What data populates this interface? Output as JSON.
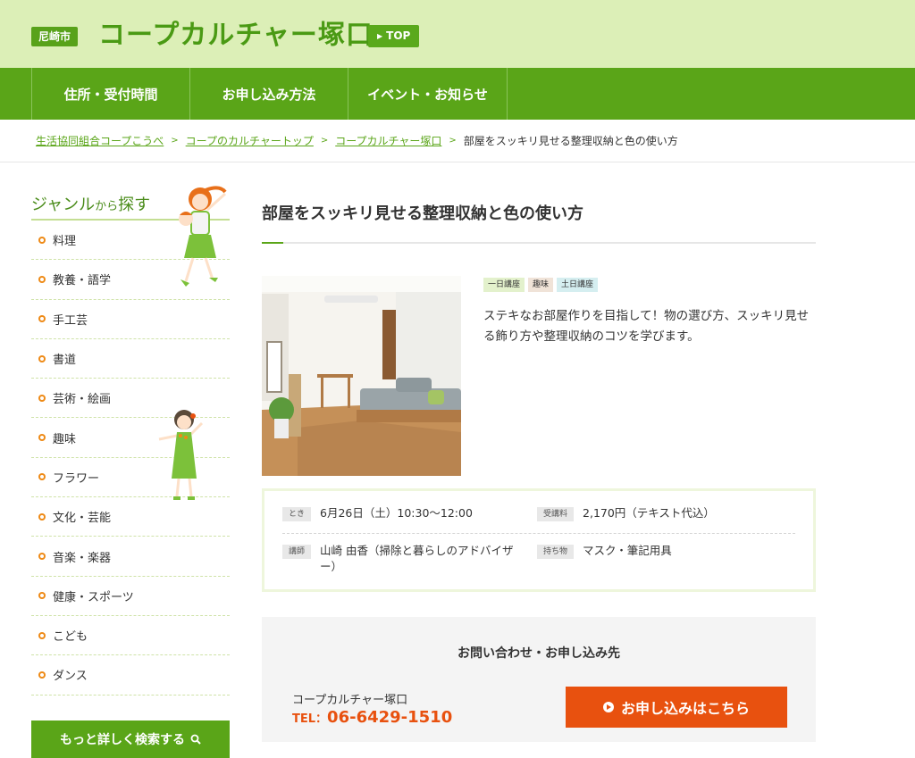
{
  "header": {
    "city_badge": "尼崎市",
    "site_title": "コープカルチャー塚口",
    "top_label": "TOP"
  },
  "nav": {
    "items": [
      "住所・受付時間",
      "お申し込み方法",
      "イベント・お知らせ"
    ]
  },
  "breadcrumb": {
    "items": [
      "生活協同組合コープこうべ",
      "コープのカルチャートップ",
      "コープカルチャー塚口"
    ],
    "current": "部屋をスッキリ見せる整理収納と色の使い方",
    "separator": ">"
  },
  "sidebar": {
    "heading_main": "ジャンル",
    "heading_small": "から",
    "heading_tail": "探す",
    "genres": [
      "料理",
      "教養・語学",
      "手工芸",
      "書道",
      "芸術・絵画",
      "趣味",
      "フラワー",
      "文化・芸能",
      "音楽・楽器",
      "健康・スポーツ",
      "こども",
      "ダンス"
    ],
    "search_more": "もっと詳しく検索する"
  },
  "main": {
    "title": "部屋をスッキリ見せる整理収納と色の使い方",
    "tags": [
      "一日講座",
      "趣味",
      "土日講座"
    ],
    "description": "ステキなお部屋作りを目指して！物の選び方、スッキリ見せる飾り方や整理収納のコツを学びます。",
    "info": {
      "when_label": "とき",
      "when_value": "6月26日（土）10:30〜12:00",
      "fee_label": "受講料",
      "fee_value": "2,170円（テキスト代込）",
      "teacher_label": "講師",
      "teacher_value": "山崎 由香（掃除と暮らしのアドバイザー）",
      "items_label": "持ち物",
      "items_value": "マスク・筆記用具"
    },
    "contact": {
      "heading": "お問い合わせ・お申し込み先",
      "name": "コープカルチャー塚口",
      "tel_label": "TEL：",
      "tel_number": "06-6429-1510",
      "apply_label": "お申し込みはこちら"
    }
  },
  "colors": {
    "brand_green": "#5aa518",
    "header_bg": "#dcefb7",
    "accent_orange": "#e8510f",
    "bullet_orange": "#ee8a16"
  }
}
